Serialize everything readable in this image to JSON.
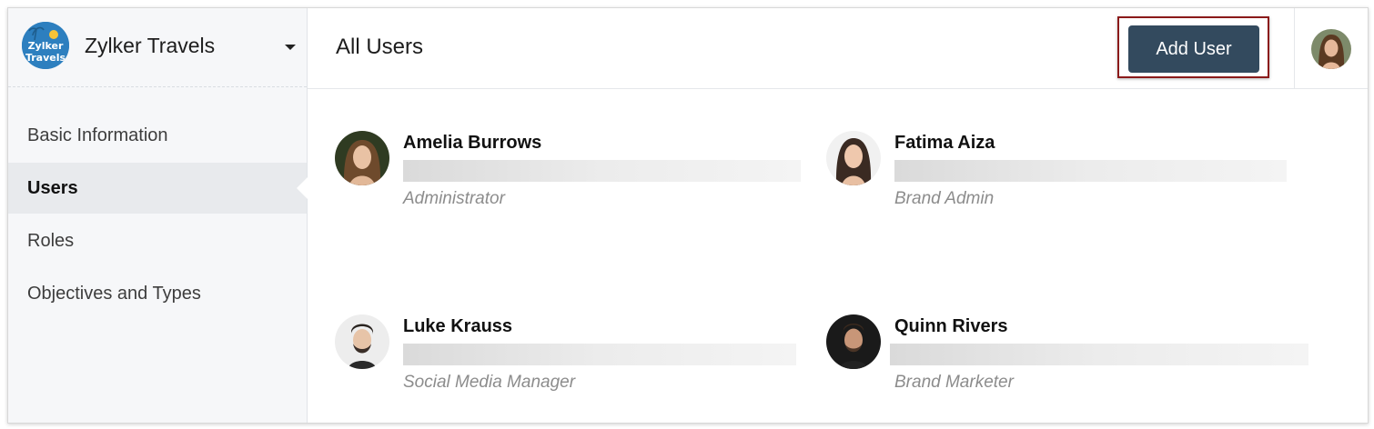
{
  "org": {
    "logo_text_line1": "Zylker",
    "logo_text_line2": "Travels",
    "name": "Zylker Travels"
  },
  "sidebar": {
    "items": [
      {
        "label": "Basic Information"
      },
      {
        "label": "Users",
        "active": true
      },
      {
        "label": "Roles"
      },
      {
        "label": "Objectives and Types"
      }
    ]
  },
  "header": {
    "title": "All Users",
    "add_user_label": "Add User"
  },
  "users": [
    {
      "name": "Amelia Burrows",
      "role": "Administrator"
    },
    {
      "name": "Fatima Aiza",
      "role": "Brand Admin"
    },
    {
      "name": "Luke Krauss",
      "role": "Social Media Manager"
    },
    {
      "name": "Quinn Rivers",
      "role": "Brand Marketer"
    }
  ],
  "colors": {
    "button_bg": "#334a5e",
    "highlight_border": "#8b1a1a",
    "sidebar_bg": "#f6f7f9",
    "logo_bg": "#2d7fbf"
  }
}
